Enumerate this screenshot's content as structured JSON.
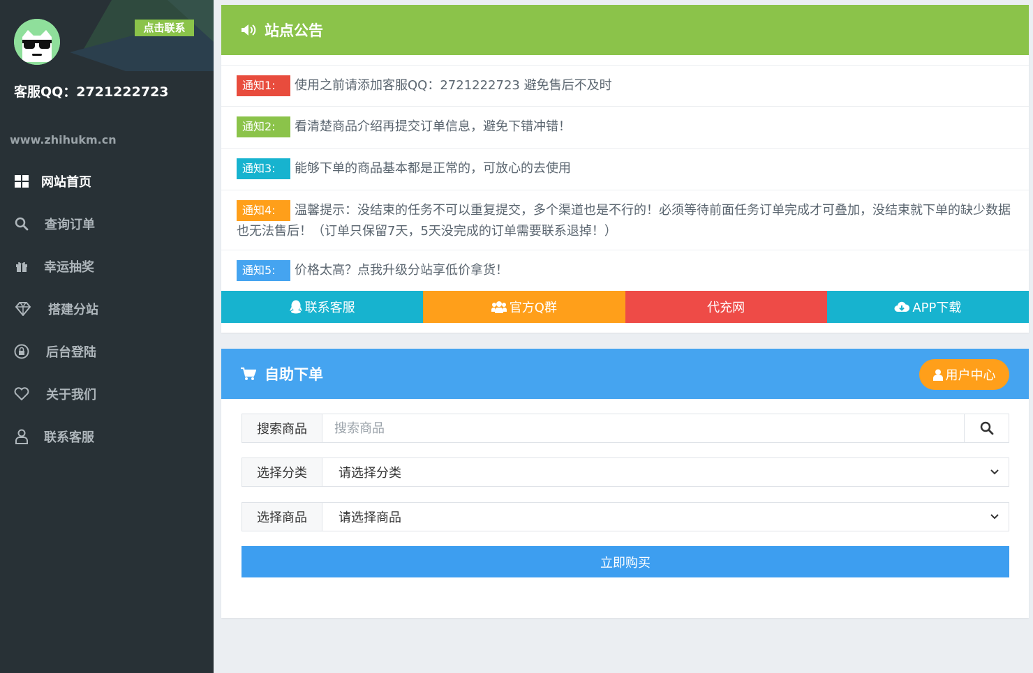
{
  "sidebar": {
    "contact_badge": "点击联系",
    "qq_text": "客服QQ：2721222723",
    "site_url": "www.zhihukm.cn",
    "menu": [
      {
        "label": "网站首页",
        "icon": "grid-icon",
        "active": true
      },
      {
        "label": "查询订单",
        "icon": "search-icon"
      },
      {
        "label": "幸运抽奖",
        "icon": "gift-icon"
      },
      {
        "label": "搭建分站",
        "icon": "diamond-icon"
      },
      {
        "label": "后台登陆",
        "icon": "lock-icon"
      },
      {
        "label": "关于我们",
        "icon": "heart-icon"
      },
      {
        "label": "联系客服",
        "icon": "user-icon"
      }
    ]
  },
  "notice": {
    "title": "站点公告",
    "items": [
      {
        "tag": "通知1:",
        "tag_color": "#e84c3d",
        "text": "使用之前请添加客服QQ：2721222723 避免售后不及时"
      },
      {
        "tag": "通知2:",
        "tag_color": "#8bc34a",
        "text": "看清楚商品介绍再提交订单信息，避免下错冲错！"
      },
      {
        "tag": "通知3:",
        "tag_color": "#17b3cf",
        "text": "能够下单的商品基本都是正常的，可放心的去使用"
      },
      {
        "tag": "通知4:",
        "tag_color": "#ff9f1a",
        "text": "温馨提示：没结束的任务不可以重复提交，多个渠道也是不行的！必须等待前面任务订单完成才可叠加，没结束就下单的缺少数据也无法售后！（订单只保留7天，5天没完成的订单需要联系退掉！）"
      },
      {
        "tag": "通知5:",
        "tag_color": "#45a4f0",
        "text": "价格太高？点我升级分站享低价拿货！"
      }
    ],
    "quick_buttons": [
      {
        "label": "联系客服",
        "color": "#17b3cf",
        "icon": "qq-icon"
      },
      {
        "label": "官方Q群",
        "color": "#ff9f1a",
        "icon": "users-icon"
      },
      {
        "label": "代充网",
        "color": "#ee4b47",
        "icon": ""
      },
      {
        "label": "APP下载",
        "color": "#17b3cf",
        "icon": "cloud-download-icon"
      }
    ]
  },
  "order": {
    "title": "自助下单",
    "user_center": "用户中心",
    "search_label": "搜索商品",
    "search_placeholder": "搜索商品",
    "category_label": "选择分类",
    "category_value": "请选择分类",
    "product_label": "选择商品",
    "product_value": "请选择商品",
    "buy_label": "立即购买"
  }
}
